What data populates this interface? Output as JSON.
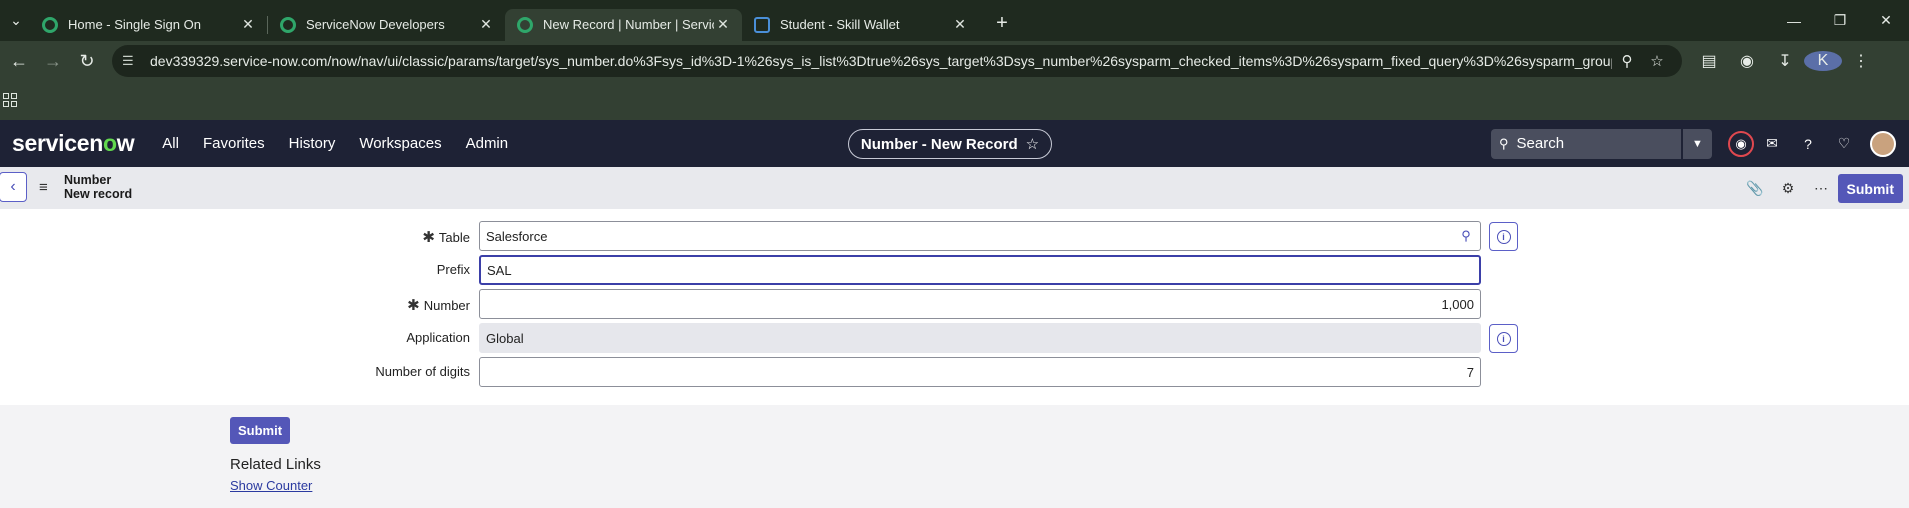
{
  "browser": {
    "tabs": [
      {
        "title": "Home - Single Sign On",
        "active": false
      },
      {
        "title": "ServiceNow Developers",
        "active": false
      },
      {
        "title": "New Record | Number | ServiceN",
        "active": true
      },
      {
        "title": "Student - Skill Wallet",
        "active": false
      }
    ],
    "url": "dev339329.service-now.com/now/nav/ui/classic/params/target/sys_number.do%3Fsys_id%3D-1%26sys_is_list%3Dtrue%26sys_target%3Dsys_number%26sysparm_checked_items%3D%26sysparm_fixed_query%3D%26sysparm_group_sor...",
    "profile_initial": "K"
  },
  "header": {
    "logo_text": "servicenow",
    "nav": [
      "All",
      "Favorites",
      "History",
      "Workspaces",
      "Admin"
    ],
    "context_title": "Number - New Record",
    "search_placeholder": "Search"
  },
  "form_header": {
    "line1": "Number",
    "line2": "New record",
    "submit_label": "Submit"
  },
  "fields": {
    "table": {
      "label": "Table",
      "value": "Salesforce",
      "required": true
    },
    "prefix": {
      "label": "Prefix",
      "value": "SAL"
    },
    "number": {
      "label": "Number",
      "value": "1,000",
      "required": true
    },
    "application": {
      "label": "Application",
      "value": "Global"
    },
    "digits": {
      "label": "Number of digits",
      "value": "7"
    }
  },
  "footer": {
    "submit_label": "Submit",
    "related_title": "Related Links",
    "related_link": "Show Counter"
  },
  "colors": {
    "accent": "#5457b8",
    "header_bg": "#1e2235",
    "browser_bg": "#334033"
  }
}
